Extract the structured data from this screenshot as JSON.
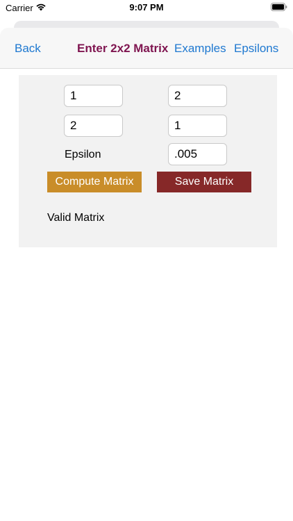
{
  "status_bar": {
    "carrier": "Carrier",
    "time": "9:07 PM",
    "wifi_icon": "wifi-icon",
    "battery_icon": "battery-icon"
  },
  "nav": {
    "back_label": "Back",
    "title": "Enter 2x2 Matrix",
    "examples_label": "Examples",
    "epsilons_label": "Epsilons"
  },
  "matrix": {
    "a11": "1",
    "a12": "2",
    "a21": "2",
    "a22": "1"
  },
  "epsilon": {
    "label": "Epsilon",
    "value": ".005"
  },
  "actions": {
    "compute_label": "Compute Matrix",
    "save_label": "Save Matrix"
  },
  "status": {
    "message": "Valid Matrix"
  },
  "colors": {
    "link": "#1e78d0",
    "title": "#7f1550",
    "compute_button": "#c98d29",
    "save_button": "#862828",
    "panel": "#f2f2f2"
  }
}
